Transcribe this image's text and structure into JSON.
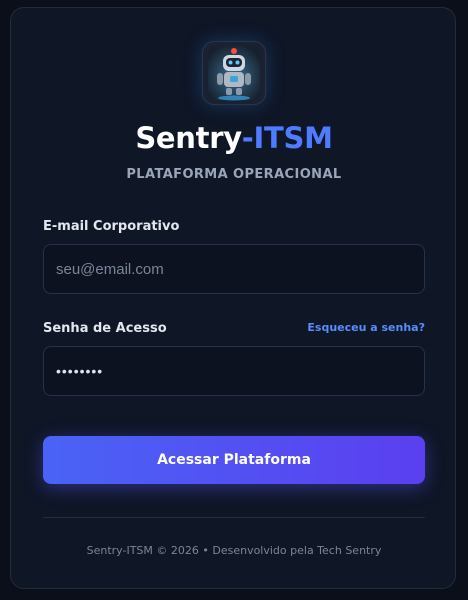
{
  "brand": {
    "name_prefix": "Sentry",
    "name_suffix": "-ITSM",
    "subtitle": "PLATAFORMA OPERACIONAL",
    "logo_icon": "robot-icon",
    "accent_color": "#4f7bff"
  },
  "form": {
    "email_label": "E-mail Corporativo",
    "email_placeholder": "seu@email.com",
    "email_value": "",
    "password_label": "Senha de Acesso",
    "forgot_link": "Esqueceu a senha?",
    "password_value": "••••••••",
    "submit_label": "Acessar Plataforma"
  },
  "footer": {
    "text": "Sentry-ITSM © 2026 • Desenvolvido pela Tech Sentry"
  }
}
